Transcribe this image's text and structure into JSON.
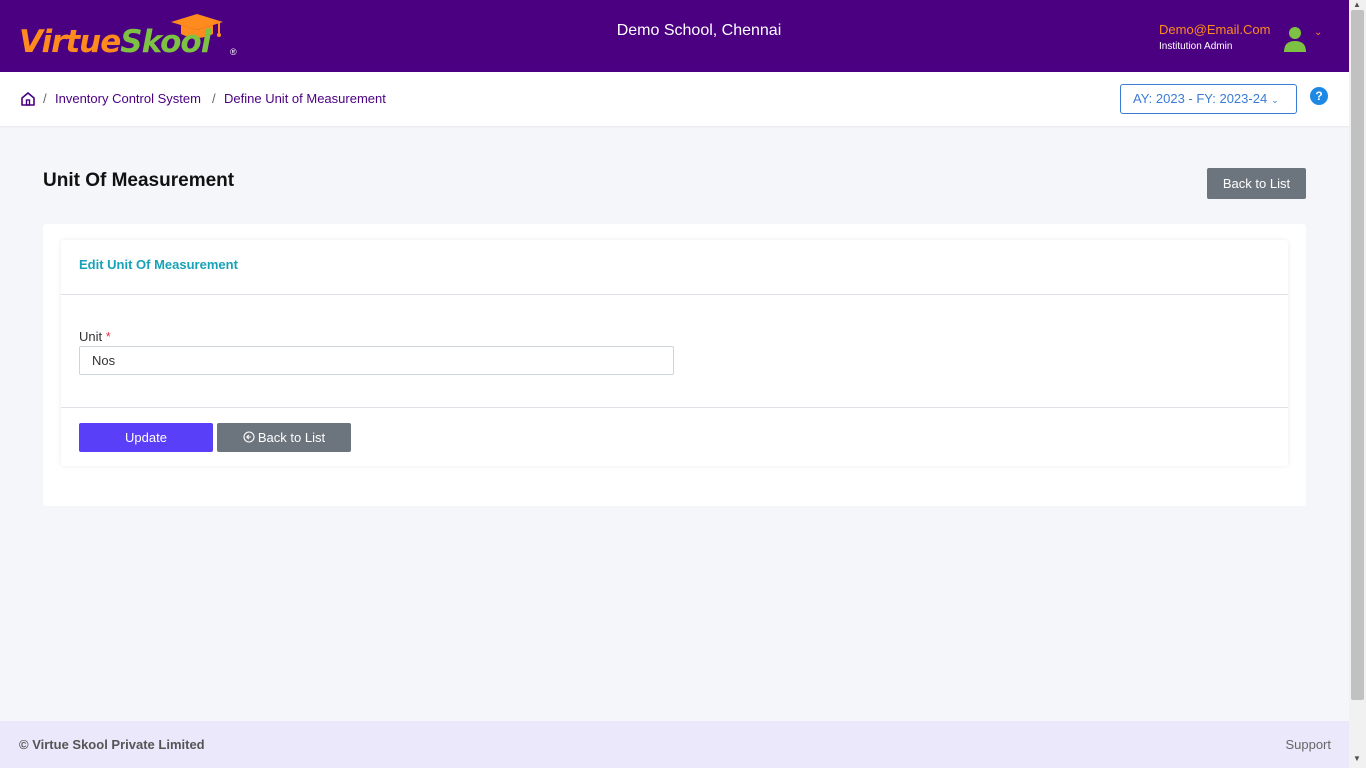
{
  "header": {
    "logo": {
      "part1": "Virtue",
      "part2": "Skool",
      "reg": "®"
    },
    "school_name": "Demo School, Chennai",
    "user": {
      "email": "Demo@Email.Com",
      "role": "Institution Admin",
      "caret": "⌄"
    }
  },
  "breadcrumb": {
    "items": [
      "Inventory Control System",
      "Define Unit of Measurement"
    ],
    "separator": "/",
    "academic_year": "AY: 2023 - FY: 2023-24",
    "academic_caret": "⌄",
    "help": "?"
  },
  "page": {
    "title": "Unit Of Measurement",
    "back_button": "Back to List"
  },
  "form": {
    "header": "Edit Unit Of Measurement",
    "unit_label": "Unit",
    "required_mark": "*",
    "unit_value": "Nos",
    "update_button": "Update",
    "back_button": "Back to List"
  },
  "footer": {
    "copyright": "© Virtue Skool Private Limited",
    "support": "Support"
  },
  "colors": {
    "header_bg": "#4b0082",
    "logo_orange": "#ff8a1e",
    "logo_green": "#7ec243",
    "link_purple": "#4b0082",
    "accent_blue": "#3a7bd5",
    "card_title_teal": "#17a2b8",
    "update_button": "#5a3ff9",
    "secondary_button": "#6c757d",
    "footer_bg": "#ebe8fc"
  },
  "icons": {
    "logo_cap": "graduation-cap-icon",
    "avatar": "user-avatar-icon",
    "home": "home-icon",
    "help": "help-icon",
    "back": "circle-arrow-left-icon"
  }
}
